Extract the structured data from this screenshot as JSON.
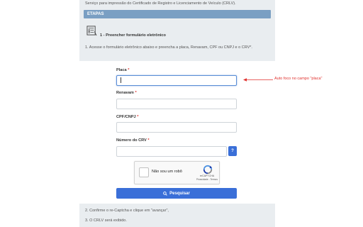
{
  "header": {
    "intro": "Serviço para impressão do Certificado de Registro e Licenciamento de Veículo (CRLV).",
    "etapas_label": "ETAPAS"
  },
  "step1": {
    "title": "1 - Preencher formulário eletrônico",
    "description": "1. Acesse o formulário eletrônico abaixo e preencha a placa, Renavam, CPF ou CNPJ e o CRV*."
  },
  "form": {
    "placa_label": "Placa",
    "placa_value": "",
    "renavam_label": "Renavam",
    "renavam_value": "",
    "cpf_label": "CPF/CNPJ",
    "cpf_value": "",
    "crv_label": "Número do CRV",
    "crv_value": "",
    "required_mark": "*",
    "help_label": "?",
    "submit_label": "Pesquisar"
  },
  "recaptcha": {
    "checkbox_label": "Não sou um robô",
    "brand": "reCAPTCHA",
    "links": "Privacidade - Termos"
  },
  "steps_after": [
    "2. Confirme o re-Captcha e clique em \"avançar\",",
    "3. O CRLV será exibido."
  ],
  "annotation": {
    "text": "Auto foco no campo \"placa\"",
    "color": "#e0312e"
  },
  "colors": {
    "accent": "#3a6fd8",
    "header_bar": "#7a9fc3",
    "panel_bg": "#e9edf0"
  }
}
